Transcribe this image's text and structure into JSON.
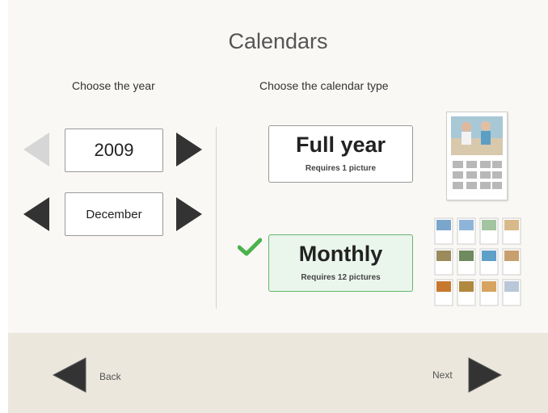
{
  "page": {
    "title": "Calendars",
    "year_heading": "Choose the year",
    "type_heading": "Choose the calendar type"
  },
  "year_selector": {
    "value": "2009"
  },
  "month_selector": {
    "value": "December"
  },
  "calendar_types": [
    {
      "label": "Full year",
      "requirement": "Requires 1 picture",
      "selected": false
    },
    {
      "label": "Monthly",
      "requirement": "Requires 12 pictures",
      "selected": true
    }
  ],
  "footer": {
    "back_label": "Back",
    "next_label": "Next"
  },
  "colors": {
    "selected_accent": "#4cb24c",
    "arrow": "#333333",
    "arrow_disabled": "#d6d6d6",
    "footer_bg": "#ebe7dd"
  },
  "icons": {
    "prev_year": "left-arrow-icon",
    "next_year": "right-arrow-icon",
    "prev_month": "left-arrow-icon",
    "next_month": "right-arrow-icon",
    "selected_mark": "checkmark-icon",
    "back": "left-arrow-icon",
    "next": "right-arrow-icon"
  }
}
